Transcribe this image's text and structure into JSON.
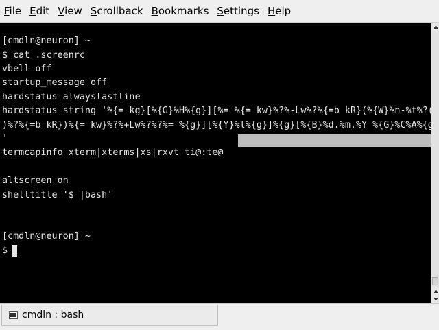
{
  "menubar": {
    "items": [
      {
        "mnemonic": "F",
        "rest": "ile"
      },
      {
        "mnemonic": "E",
        "rest": "dit"
      },
      {
        "mnemonic": "V",
        "rest": "iew"
      },
      {
        "mnemonic": "S",
        "rest": "crollback"
      },
      {
        "mnemonic": "B",
        "rest": "ookmarks"
      },
      {
        "mnemonic": "S",
        "rest": "ettings"
      },
      {
        "mnemonic": "H",
        "rest": "elp"
      }
    ]
  },
  "terminal": {
    "lines": [
      "[cmdln@neuron] ~",
      "$ cat .screenrc",
      "vbell off",
      "startup_message off",
      "hardstatus alwayslastline",
      "hardstatus string '%{= kg}[%{G}%H%{g}][%= %{= kw}%?%-Lw%?%{=b kR}(%{W}%n-%t%?(%u",
      ")%?%{=b kR})%{= kw}%?%+Lw%?%?%= %{g}][%{Y}%l%{g}]%{g}[%{B}%d.%m.%Y %{G}%C%A%{g}]",
      "'",
      "termcapinfo xterm|xterms|xs|rxvt ti@:te@",
      "",
      "altscreen on",
      "shelltitle '$ |bash'",
      "",
      "",
      "[cmdln@neuron] ~",
      "$ "
    ]
  },
  "tabbar": {
    "tabs": [
      {
        "label": "cmdln : bash",
        "icon": "terminal-icon"
      }
    ]
  },
  "colors": {
    "terminal_bg": "#000000",
    "terminal_fg": "#e6e6e6",
    "selection": "#bdbdbd",
    "chrome": "#efefef"
  }
}
